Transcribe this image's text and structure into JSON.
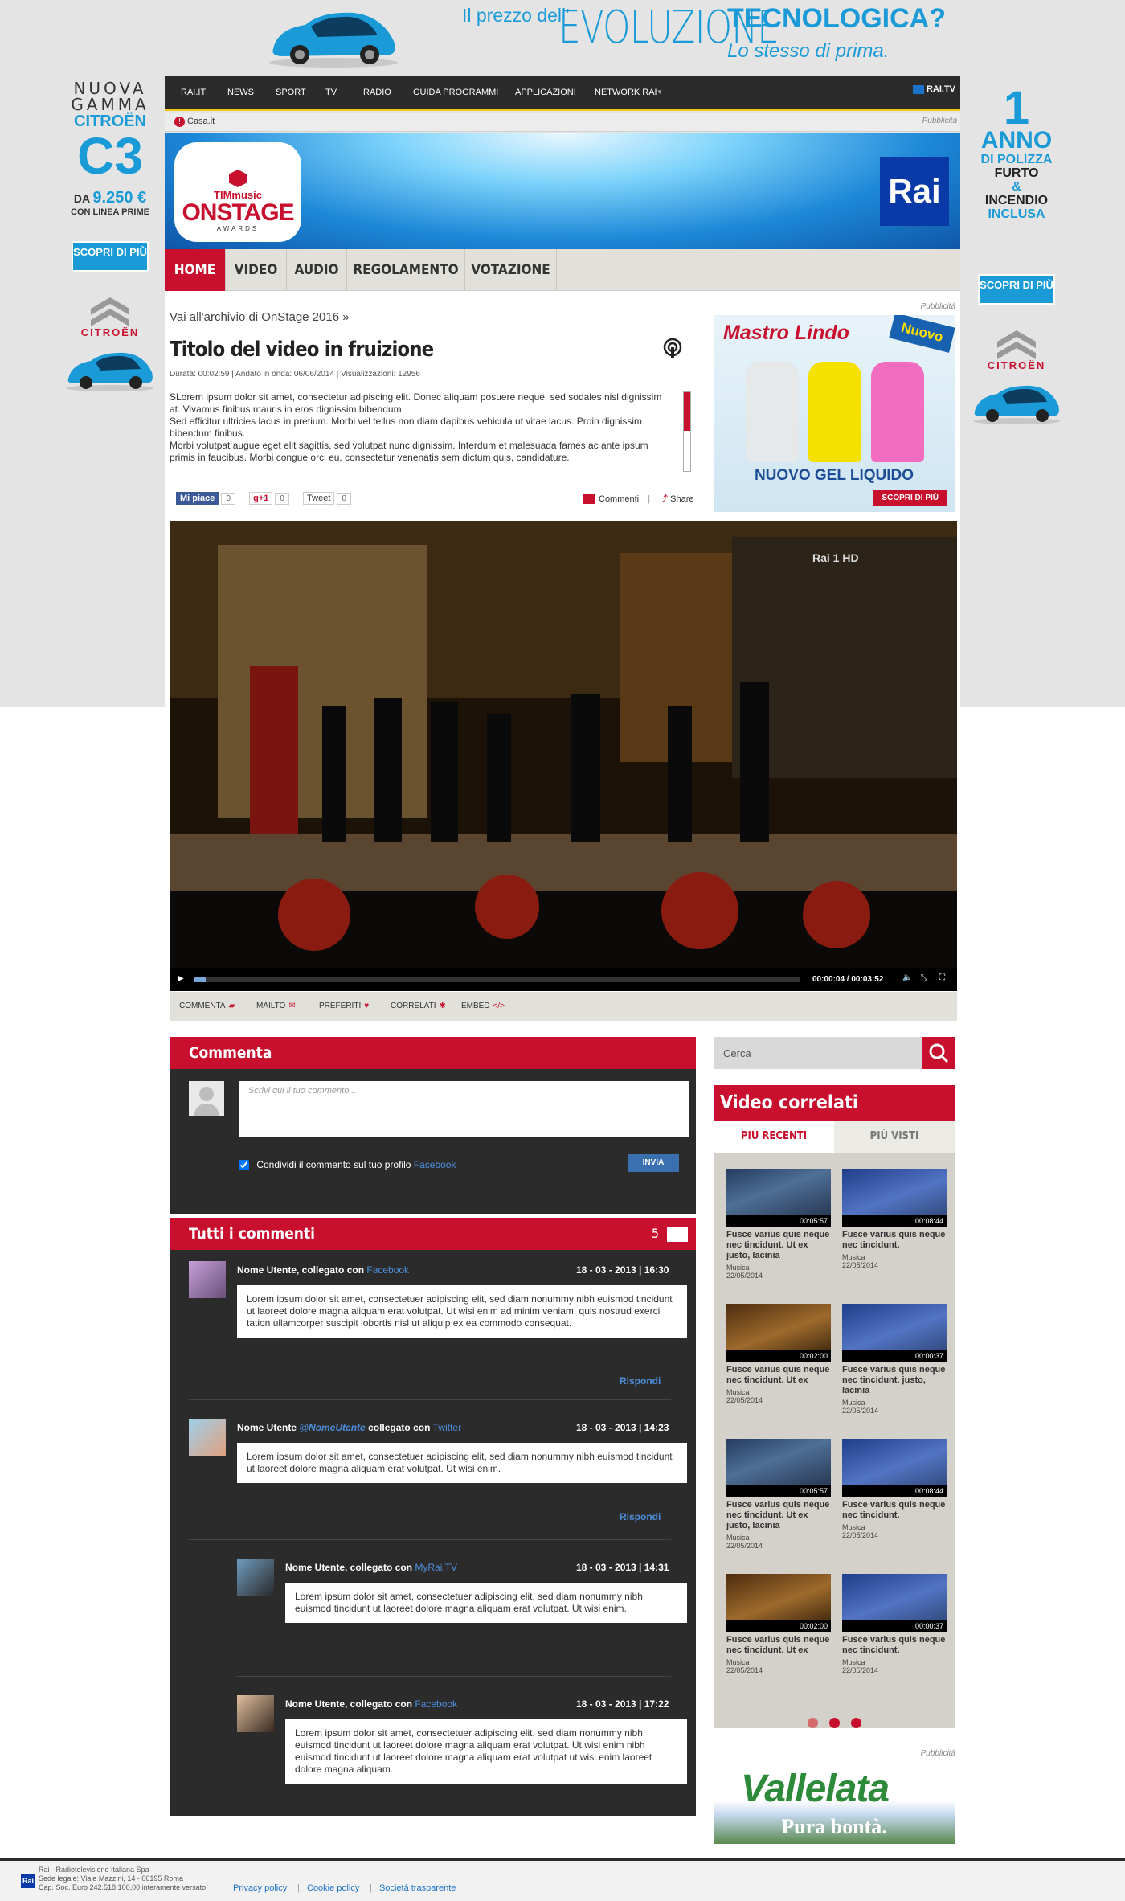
{
  "top_ad": {
    "line1": "Il prezzo dell'",
    "line2": "EVOLUZIONE",
    "line3": "TECNOLOGICA?",
    "line4": "Lo stesso di prima."
  },
  "left_ad": {
    "l1": "NUOVA",
    "l2": "GAMMA",
    "brand": "CITROËN",
    "model": "C3",
    "price_prefix": "DA",
    "price": "9.250 €",
    "price_note": "CON LINEA PRIME",
    "cta": "SCOPRI DI PIÙ",
    "logo_text": "CITROËN"
  },
  "right_ad": {
    "one": "1",
    "anno": "ANNO",
    "l1": "DI POLIZZA",
    "l2": "FURTO",
    "l3": "&",
    "l4": "INCENDIO",
    "l5": "INCLUSA",
    "cta": "SCOPRI DI PIÙ",
    "logo_text": "CITROËN"
  },
  "nav": {
    "items": [
      "RAI.IT",
      "NEWS",
      "SPORT",
      "TV",
      "RADIO",
      "GUIDA PROGRAMMI",
      "APPLICAZIONI",
      "NETWORK RAI"
    ],
    "raitv": "RAI.TV"
  },
  "subnav": {
    "casa": "Casa.it",
    "pub": "Pubblicità"
  },
  "banner": {
    "logo_a": "TIMmusic",
    "logo_b": "ONSTAGE",
    "logo_c": "AWARDS",
    "rai": "Rai"
  },
  "menu": {
    "items": [
      "HOME",
      "VIDEO",
      "AUDIO",
      "REGOLAMENTO",
      "VOTAZIONE"
    ]
  },
  "video": {
    "archive": "Vai all'archivio di OnStage 2016 »",
    "title": "Titolo del video in fruizione",
    "meta": "Durata: 00:02:59   |   Andato in onda: 06/06/2014   |   Visualizzazioni: 12956",
    "desc1": "SLorem ipsum dolor sit amet, consectetur adipiscing elit. Donec aliquam posuere neque, sed sodales nisl dignissim at. Vivamus finibus mauris in eros dignissim bibendum.",
    "desc2": "Sed efficitur ultricies lacus in pretium. Morbi vel tellus non diam dapibus vehicula ut vitae lacus. Proin dignissim bibendum finibus.",
    "desc3": "Morbi volutpat augue eget elit sagittis, sed volutpat nunc dignissim. Interdum et malesuada fames ac ante ipsum primis in faucibus. Morbi congue orci eu, consectetur venenatis sem dictum quis, candidature.",
    "time": "00:00:04 / 00:03:52",
    "channel": "Rai 1 HD",
    "progress": 0.02
  },
  "social": {
    "fb": "Mi piace",
    "fb_n": "0",
    "gp": "g+1",
    "gp_n": "0",
    "tw": "Tweet",
    "tw_n": "0",
    "commenti": "Commenti",
    "share": "Share"
  },
  "actions": [
    "COMMENTA",
    "MAILTO",
    "PREFERITI",
    "CORRELATI",
    "EMBED"
  ],
  "ad_mr": {
    "pub": "Pubblicità",
    "brand": "Mastro Lindo",
    "badge": "Nuovo",
    "claim": "NUOVO GEL LIQUIDO",
    "cta": "SCOPRI DI PIÙ"
  },
  "comment": {
    "title": "Commenta",
    "placeholder": "Scrivi qui il tuo commento...",
    "share": "Condividi il commento sul tuo profilo",
    "share_link": "Facebook",
    "submit": "INVIA"
  },
  "comments": {
    "title": "Tutti i commenti",
    "count": "5",
    "reply": "Rispondi",
    "items": [
      {
        "name": "Nome Utente, collegato con ",
        "src": "Facebook",
        "date": "18 - 03 - 2013 | 16:30",
        "body": "Lorem ipsum dolor sit amet, consectetuer adipiscing elit, sed diam nonummy nibh euismod tincidunt ut laoreet dolore magna aliquam erat volutpat. Ut wisi enim ad minim veniam, quis nostrud exerci tation ullamcorper suscipit lobortis nisl ut aliquip ex ea commodo consequat."
      },
      {
        "name": "Nome Utente ",
        "handle": "@NomeUtente",
        "mid": " collegato con ",
        "src": "Twitter",
        "date": "18 - 03 - 2013 | 14:23",
        "body": "Lorem ipsum dolor sit amet, consectetuer adipiscing elit, sed diam nonummy nibh euismod tincidunt ut laoreet dolore magna aliquam erat volutpat. Ut wisi enim."
      },
      {
        "name": "Nome Utente, collegato con ",
        "src": "MyRai.TV",
        "date": "18 - 03 - 2013 | 14:31",
        "body": "Lorem ipsum dolor sit amet, consectetuer adipiscing elit, sed diam nonummy nibh euismod tincidunt ut laoreet dolore magna aliquam erat volutpat. Ut wisi enim."
      },
      {
        "name": "Nome Utente, collegato con ",
        "src": "Facebook",
        "date": "18 - 03 - 2013 | 17:22",
        "body": "Lorem ipsum dolor sit amet, consectetuer adipiscing elit, sed diam nonummy nibh euismod tincidunt ut laoreet dolore magna aliquam erat volutpat. Ut wisi enim nibh euismod tincidunt ut laoreet dolore magna aliquam erat volutpat ut wisi enim laoreet dolore magna aliquam."
      }
    ]
  },
  "search": {
    "placeholder": "Cerca"
  },
  "related": {
    "title": "Video correlati",
    "tab1": "PIÙ RECENTI",
    "tab2": "PIÙ VISTI",
    "items": [
      {
        "dur": "00:05:57",
        "title": "Fusce varius quis neque nec tincidunt. Ut ex justo, lacinia",
        "cat": "Musica",
        "date": "22/05/2014"
      },
      {
        "dur": "00:08:44",
        "title": "Fusce varius quis neque nec tincidunt.",
        "cat": "Musica",
        "date": "22/05/2014"
      },
      {
        "dur": "00:02:00",
        "title": "Fusce varius quis neque nec tincidunt. Ut ex",
        "cat": "Musica",
        "date": "22/05/2014"
      },
      {
        "dur": "00:00:37",
        "title": "Fusce varius quis neque nec tincidunt. justo, lacinia",
        "cat": "Musica",
        "date": "22/05/2014"
      },
      {
        "dur": "00:05:57",
        "title": "Fusce varius quis neque nec tincidunt. Ut ex justo, lacinia",
        "cat": "Musica",
        "date": "22/05/2014"
      },
      {
        "dur": "00:08:44",
        "title": "Fusce varius quis neque nec tincidunt.",
        "cat": "Musica",
        "date": "22/05/2014"
      },
      {
        "dur": "00:02:00",
        "title": "Fusce varius quis neque nec tincidunt. Ut ex",
        "cat": "Musica",
        "date": "22/05/2014"
      },
      {
        "dur": "00:00:37",
        "title": "Fusce varius quis neque nec tincidunt.",
        "cat": "Musica",
        "date": "22/05/2014"
      }
    ]
  },
  "ad_bottom": {
    "pub": "Pubblicità",
    "brand": "Vallelata",
    "claim": "Pura bontà."
  },
  "footer": {
    "l1": "Rai - Radiotelevisione Italiana Spa",
    "l2": "Sede legale: Viale Mazzini, 14 - 00195 Roma",
    "l3": "Cap. Soc. Euro 242.518.100,00 interamente versato",
    "links": [
      "Privacy policy",
      "Cookie policy",
      "Società trasparente"
    ],
    "rai": "Rai"
  }
}
